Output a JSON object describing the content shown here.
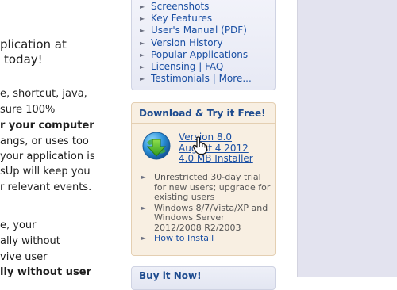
{
  "main": {
    "lines": [
      "plication at",
      "today!",
      "e, shortcut, java,",
      "sure 100%",
      "r your computer",
      "angs, or uses too",
      "your application is",
      "sUp will keep you",
      "r relevant events.",
      "e, your",
      "ally without",
      "vive user",
      "lly without user"
    ]
  },
  "nav": {
    "items": [
      {
        "label": "Screenshots"
      },
      {
        "label": "Key Features"
      },
      {
        "label": "User's Manual (PDF)"
      },
      {
        "label": "Version History"
      },
      {
        "label": "Popular Applications"
      },
      {
        "label": "Licensing"
      },
      {
        "label": "FAQ"
      },
      {
        "label": "Testimonials"
      },
      {
        "label": "More..."
      }
    ],
    "separator": "|"
  },
  "download": {
    "title": "Download & Try it Free!",
    "version_link": "Version 8.0",
    "date_link": "August 4 2012",
    "installer_link": "4.0 MB Installer",
    "info": [
      "Unrestricted 30-day trial for new users; upgrade for existing users",
      "Windows 8/7/Vista/XP and Windows Server 2012/2008 R2/2003",
      "How to Install"
    ],
    "icon": "download-globe-icon"
  },
  "buy": {
    "title": "Buy it Now!"
  },
  "cursor": {
    "icon": "hand-pointer-icon"
  },
  "colors": {
    "link": "#1a4fa3",
    "header": "#1d4b8f",
    "download_bg": "#f8efe2",
    "nav_bg": "#eceef7",
    "side_bg": "#e3e3ef"
  }
}
